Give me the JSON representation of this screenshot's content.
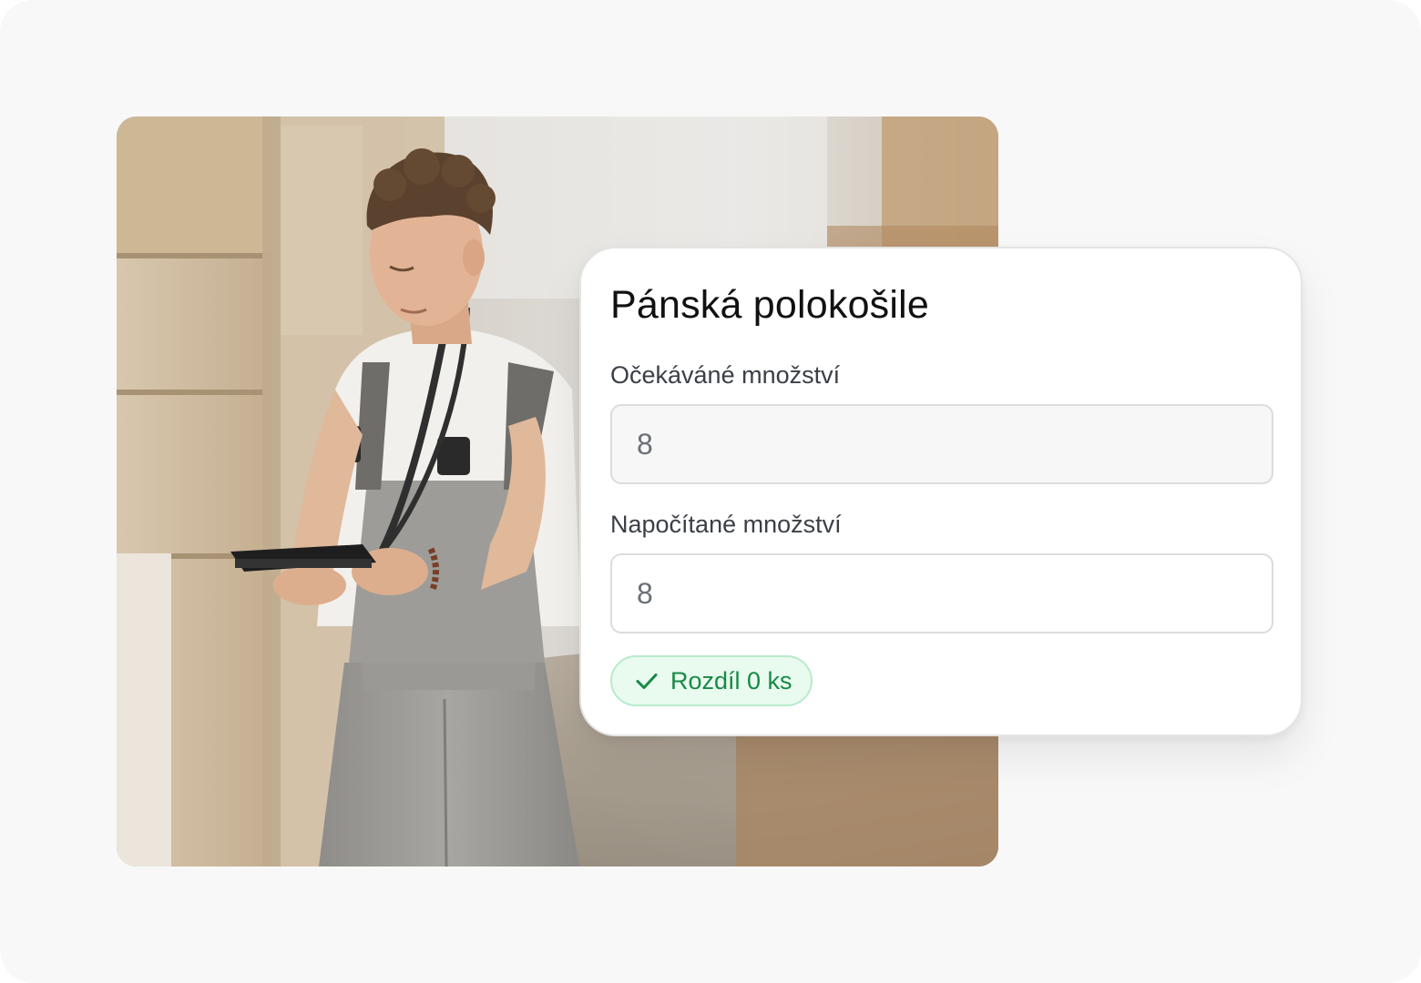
{
  "card": {
    "title": "Pánská polokošile",
    "expected": {
      "label": "Očekáváné množství",
      "value": "8"
    },
    "counted": {
      "label": "Napočítané množství",
      "value": "8"
    },
    "difference": {
      "icon": "check-icon",
      "text": "Rozdíl 0 ks"
    }
  },
  "colors": {
    "page_background": "#f8f8f8",
    "card_background": "#ffffff",
    "success_text": "#178a45",
    "success_background": "#e9faef",
    "success_border": "#b8ebcb"
  }
}
